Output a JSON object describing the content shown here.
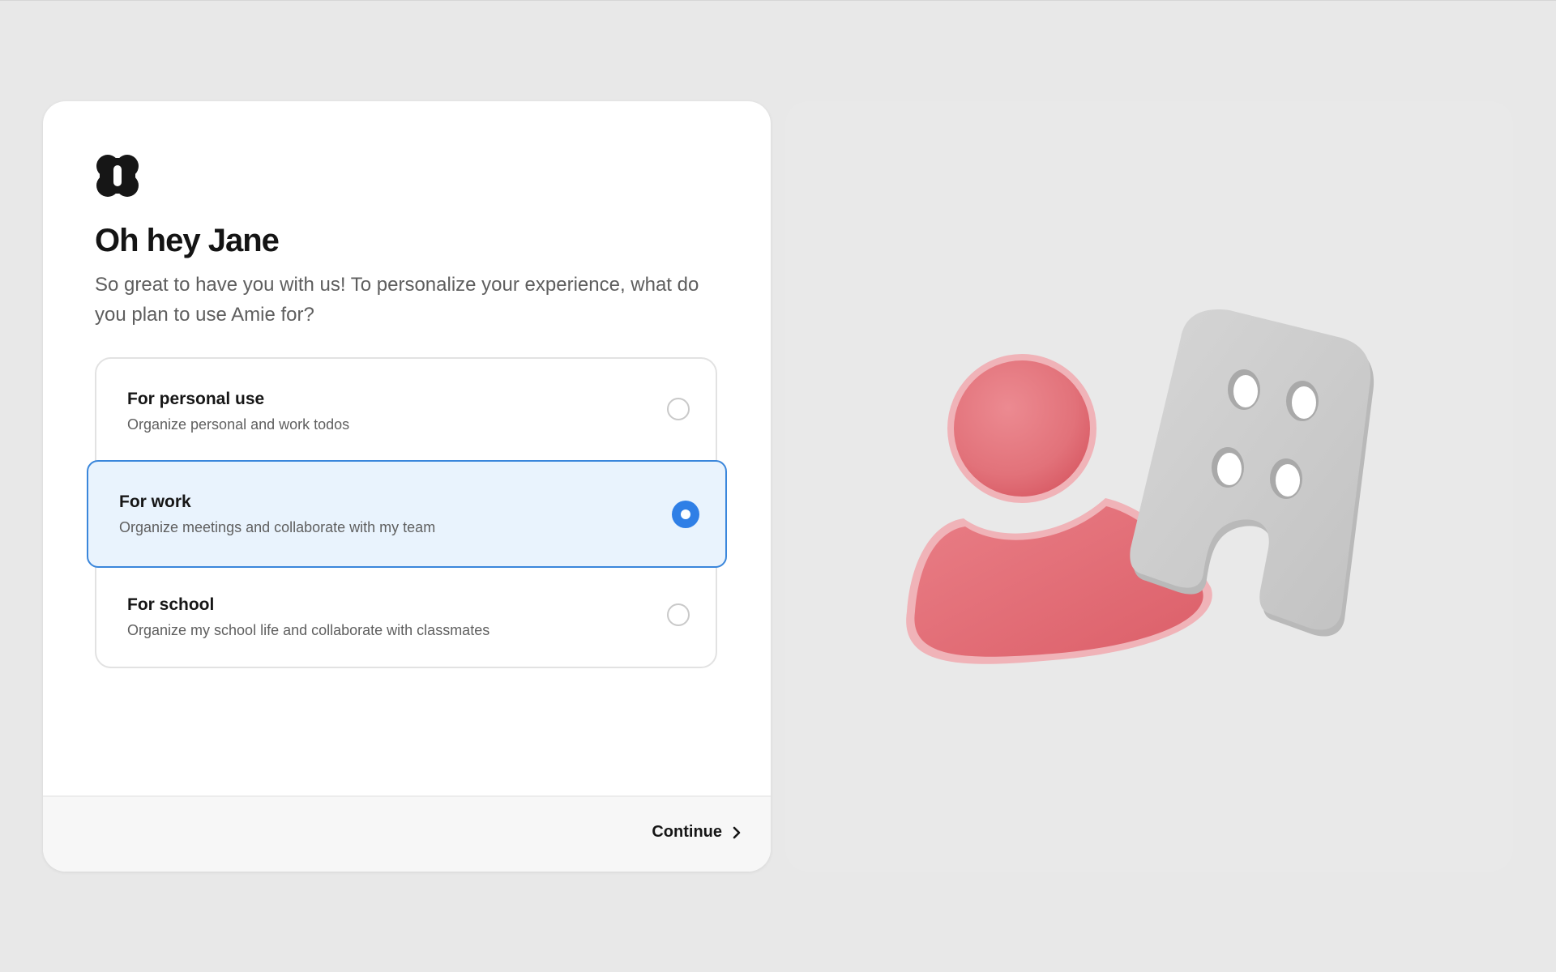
{
  "app": {
    "logo_icon": "amie-logo-icon"
  },
  "onboarding": {
    "title": "Oh hey Jane",
    "subtitle": "So great to have you with us! To personalize your experience, what do you plan to use Amie for?",
    "options": [
      {
        "title": "For personal use",
        "description": "Organize personal and work todos",
        "selected": false
      },
      {
        "title": "For work",
        "description": "Organize meetings and collaborate with my team",
        "selected": true
      },
      {
        "title": "For school",
        "description": "Organize my school life and collaborate with classmates",
        "selected": false
      }
    ]
  },
  "footer": {
    "continue_label": "Continue",
    "continue_icon": "chevron-right-icon"
  },
  "illustration": {
    "icons": [
      "user-figure-icon",
      "building-icon"
    ]
  },
  "colors": {
    "accent": "#2f7fe6",
    "selected_bg": "#e9f3fd",
    "selected_border": "#3a86db",
    "illustration_red": "#e5727a",
    "illustration_gray": "#cdcdcd"
  }
}
